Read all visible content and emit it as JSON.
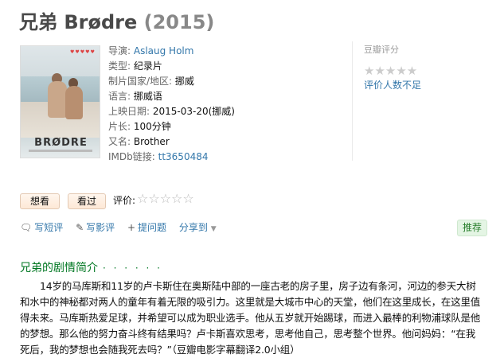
{
  "title": {
    "name": "兄弟 Brødre",
    "year": "(2015)"
  },
  "poster": {
    "title_text": "BRØDRE",
    "hearts": "♥♥♥♥♥"
  },
  "info": {
    "director_label": "导演:",
    "director": "Aslaug Holm",
    "genre_label": "类型:",
    "genre": "纪录片",
    "country_label": "制片国家/地区:",
    "country": "挪威",
    "language_label": "语言:",
    "language": "挪威语",
    "release_label": "上映日期:",
    "release": "2015-03-20(挪威)",
    "runtime_label": "片长:",
    "runtime": "100分钟",
    "aka_label": "又名:",
    "aka": "Brother",
    "imdb_label": "IMDb链接:",
    "imdb": "tt3650484"
  },
  "rating": {
    "label": "豆瓣评分",
    "stars": "★★★★★",
    "few_ratings": "评价人数不足"
  },
  "buttons": {
    "want": "想看",
    "seen": "看过",
    "rate_label": "评价:",
    "rate_stars": "☆☆☆☆☆"
  },
  "actions": {
    "short_review": "写短评",
    "review": "写影评",
    "question": "提问题",
    "share": "分享到",
    "recommend": "推荐"
  },
  "intro": {
    "heading": "兄弟的剧情简介",
    "dots": "· · · · · ·",
    "text": "14岁的马库斯和11岁的卢卡斯住在奥斯陆中部的一座古老的房子里，房子边有条河，河边的参天大树和水中的神秘都对两人的童年有着无限的吸引力。这里就是大城市中心的天堂，他们在这里成长，在这里值得未来。马库斯热爱足球，并希望可以成为职业选手。他从五岁就开始踢球，而进入最棒的利物浦球队是他的梦想。那么他的努力奋斗终有结果吗？卢卡斯喜欢思考，思考他自己，思考整个世界。他问妈妈：“在我死后，我的梦想也会随我死去吗？”（豆瓣电影字幕翻译2.0小组）"
  }
}
